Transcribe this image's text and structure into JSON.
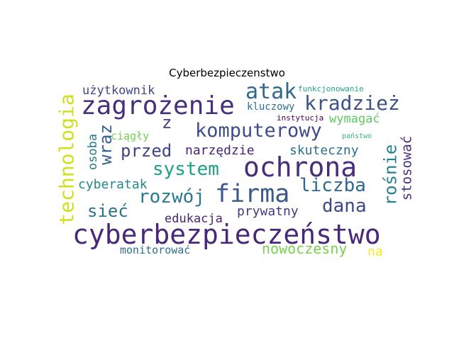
{
  "title": "Cyberbezpieczenstwo",
  "words": [
    {
      "text": "cyberbezpieczeństwo",
      "color": "#482878"
    },
    {
      "text": "ochrona",
      "color": "#472d7b"
    },
    {
      "text": "firma",
      "color": "#38598c"
    },
    {
      "text": "zagrożenie",
      "color": "#46307e"
    },
    {
      "text": "technologia",
      "color": "#d0e11c"
    },
    {
      "text": "atak",
      "color": "#31688e"
    },
    {
      "text": "kradzież",
      "color": "#3b528b"
    },
    {
      "text": "komputerowy",
      "color": "#3e4c8a"
    },
    {
      "text": "system",
      "color": "#1f9e89"
    },
    {
      "text": "rozwój",
      "color": "#2a788e"
    },
    {
      "text": "liczba",
      "color": "#31688e"
    },
    {
      "text": "dana",
      "color": "#3e4989"
    },
    {
      "text": "rośnie",
      "color": "#26828e"
    },
    {
      "text": "przed",
      "color": "#414487"
    },
    {
      "text": "wraz",
      "color": "#35608d"
    },
    {
      "text": "sieć",
      "color": "#2c728e"
    },
    {
      "text": "nowoczesny",
      "color": "#7ad151"
    },
    {
      "text": "stosować",
      "color": "#472f7d"
    },
    {
      "text": "z",
      "color": "#433e85"
    },
    {
      "text": "cyberatak",
      "color": "#25858e"
    },
    {
      "text": "skuteczny",
      "color": "#2d708e"
    },
    {
      "text": "prywatny",
      "color": "#443983"
    },
    {
      "text": "narzędzie",
      "color": "#482475"
    },
    {
      "text": "użytkownik",
      "color": "#3f4788"
    },
    {
      "text": "wymagać",
      "color": "#5ec962"
    },
    {
      "text": "edukacja",
      "color": "#481f70"
    },
    {
      "text": "monitorować",
      "color": "#2d708e"
    },
    {
      "text": "osoba",
      "color": "#29798e"
    },
    {
      "text": "ciągły",
      "color": "#75d054"
    },
    {
      "text": "kluczowy",
      "color": "#2c728e"
    },
    {
      "text": "na",
      "color": "#fde725"
    },
    {
      "text": "funkcjonowanie",
      "color": "#20a486"
    },
    {
      "text": "instytucja",
      "color": "#440154"
    },
    {
      "text": "państwo",
      "color": "#35b779"
    }
  ]
}
